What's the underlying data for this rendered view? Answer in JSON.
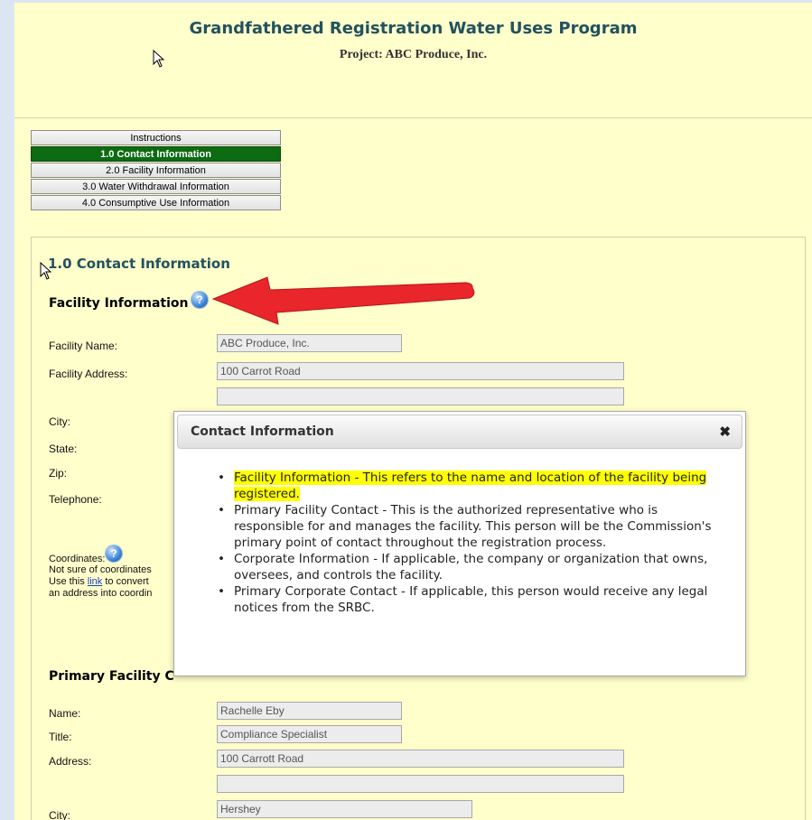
{
  "header": {
    "title": "Grandfathered Registration Water Uses Program",
    "project": "Project: ABC Produce, Inc."
  },
  "tabs": [
    {
      "label": "Instructions",
      "active": false
    },
    {
      "label": "1.0 Contact Information",
      "active": true
    },
    {
      "label": "2.0 Facility Information",
      "active": false
    },
    {
      "label": "3.0 Water Withdrawal Information",
      "active": false
    },
    {
      "label": "4.0 Consumptive Use Information",
      "active": false
    }
  ],
  "section": {
    "title": "1.0 Contact Information",
    "facility_heading": "Facility Information",
    "facility_labels": {
      "name": "Facility Name:",
      "address": "Facility Address:",
      "city": "City:",
      "state": "State:",
      "zip": "Zip:",
      "telephone": "Telephone:",
      "coordinates": "Coordinates:"
    },
    "facility_values": {
      "name": "ABC Produce, Inc.",
      "address1": "100 Carrot Road",
      "address2": ""
    },
    "coord_note": {
      "line1": "Not sure of coordinates",
      "line2_pre": "Use this ",
      "link": "link",
      "line2_post": " to convert",
      "line3": "an address into coordin"
    },
    "primary_heading": "Primary Facility C",
    "primary_labels": {
      "name": "Name:",
      "title": "Title:",
      "address": "Address:",
      "city": "City:"
    },
    "primary_values": {
      "name": "Rachelle Eby",
      "title": "Compliance Specialist",
      "address1": "100 Carrott Road",
      "address2": "",
      "city": "Hershey"
    }
  },
  "modal": {
    "title": "Contact Information",
    "close_glyph": "✖",
    "items": [
      "Facility Information - This refers to the name and location of the facility being registered.",
      "Primary Facility Contact - This is the authorized representative who is responsible for and manages the facility. This person will be the Commission's primary point of contact throughout the registration process.",
      "Corporate Information - If applicable, the company or organization that owns, oversees, and controls the facility.",
      "Primary Corporate Contact - If applicable, this person would receive any legal notices from the SRBC."
    ]
  },
  "icons": {
    "help": "help-icon",
    "arrow": "red-arrow-icon",
    "cursor": "mouse-cursor-icon",
    "accent_color": "#0d6b12",
    "highlight_color": "#ffff00",
    "arrow_color": "#e8262b"
  }
}
